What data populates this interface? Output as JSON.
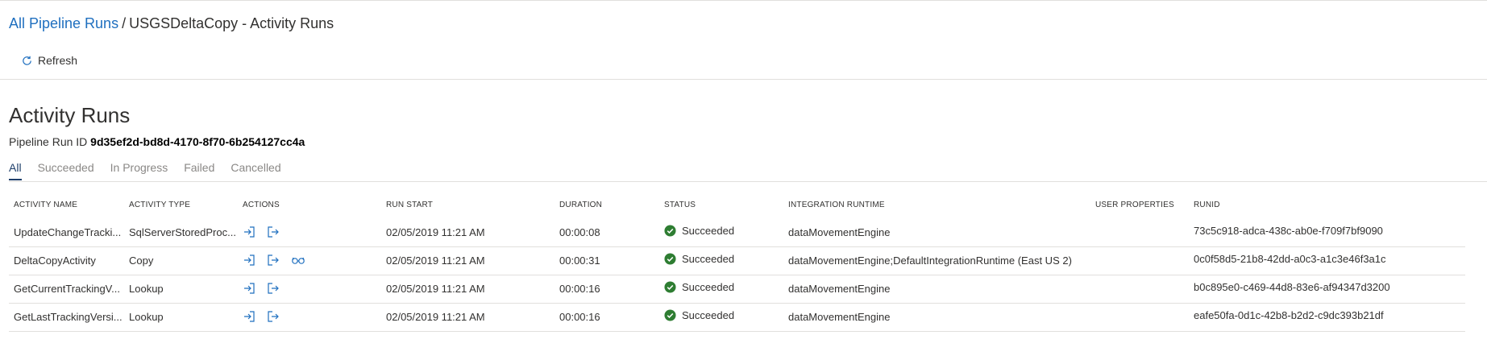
{
  "breadcrumb": {
    "link": "All Pipeline Runs",
    "separator": "/",
    "current": "USGSDeltaCopy - Activity Runs"
  },
  "toolbar": {
    "refresh_label": "Refresh"
  },
  "page": {
    "title": "Activity Runs",
    "run_id_label": "Pipeline Run ID",
    "run_id_value": "9d35ef2d-bd8d-4170-8f70-6b254127cc4a"
  },
  "tabs": [
    "All",
    "Succeeded",
    "In Progress",
    "Failed",
    "Cancelled"
  ],
  "columns": {
    "name": "ACTIVITY NAME",
    "type": "ACTIVITY TYPE",
    "actions": "ACTIONS",
    "start": "RUN START",
    "duration": "DURATION",
    "status": "STATUS",
    "ir": "INTEGRATION RUNTIME",
    "props": "USER PROPERTIES",
    "runid": "RUNID"
  },
  "rows": [
    {
      "name": "UpdateChangeTracki...",
      "type": "SqlServerStoredProc...",
      "start": "02/05/2019 11:21 AM",
      "duration": "00:00:08",
      "status": "Succeeded",
      "ir": "dataMovementEngine",
      "props": "",
      "runid": "73c5c918-adca-438c-ab0e-f709f7bf9090",
      "details": false
    },
    {
      "name": "DeltaCopyActivity",
      "type": "Copy",
      "start": "02/05/2019 11:21 AM",
      "duration": "00:00:31",
      "status": "Succeeded",
      "ir": "dataMovementEngine;DefaultIntegrationRuntime (East US 2)",
      "props": "",
      "runid": "0c0f58d5-21b8-42dd-a0c3-a1c3e46f3a1c",
      "details": true
    },
    {
      "name": "GetCurrentTrackingV...",
      "type": "Lookup",
      "start": "02/05/2019 11:21 AM",
      "duration": "00:00:16",
      "status": "Succeeded",
      "ir": "dataMovementEngine",
      "props": "",
      "runid": "b0c895e0-c469-44d8-83e6-af94347d3200",
      "details": false
    },
    {
      "name": "GetLastTrackingVersi...",
      "type": "Lookup",
      "start": "02/05/2019 11:21 AM",
      "duration": "00:00:16",
      "status": "Succeeded",
      "ir": "dataMovementEngine",
      "props": "",
      "runid": "eafe50fa-0d1c-42b8-b2d2-c9dc393b21df",
      "details": false
    }
  ],
  "icons": {
    "refresh": "refresh-icon",
    "input": "input-icon",
    "output": "output-icon",
    "details": "details-glasses-icon",
    "success": "success-check-icon"
  },
  "colors": {
    "link": "#1f6fbf",
    "action_icon": "#1f6fbf",
    "success": "#2e7d32",
    "divider": "#e1dfdd"
  }
}
